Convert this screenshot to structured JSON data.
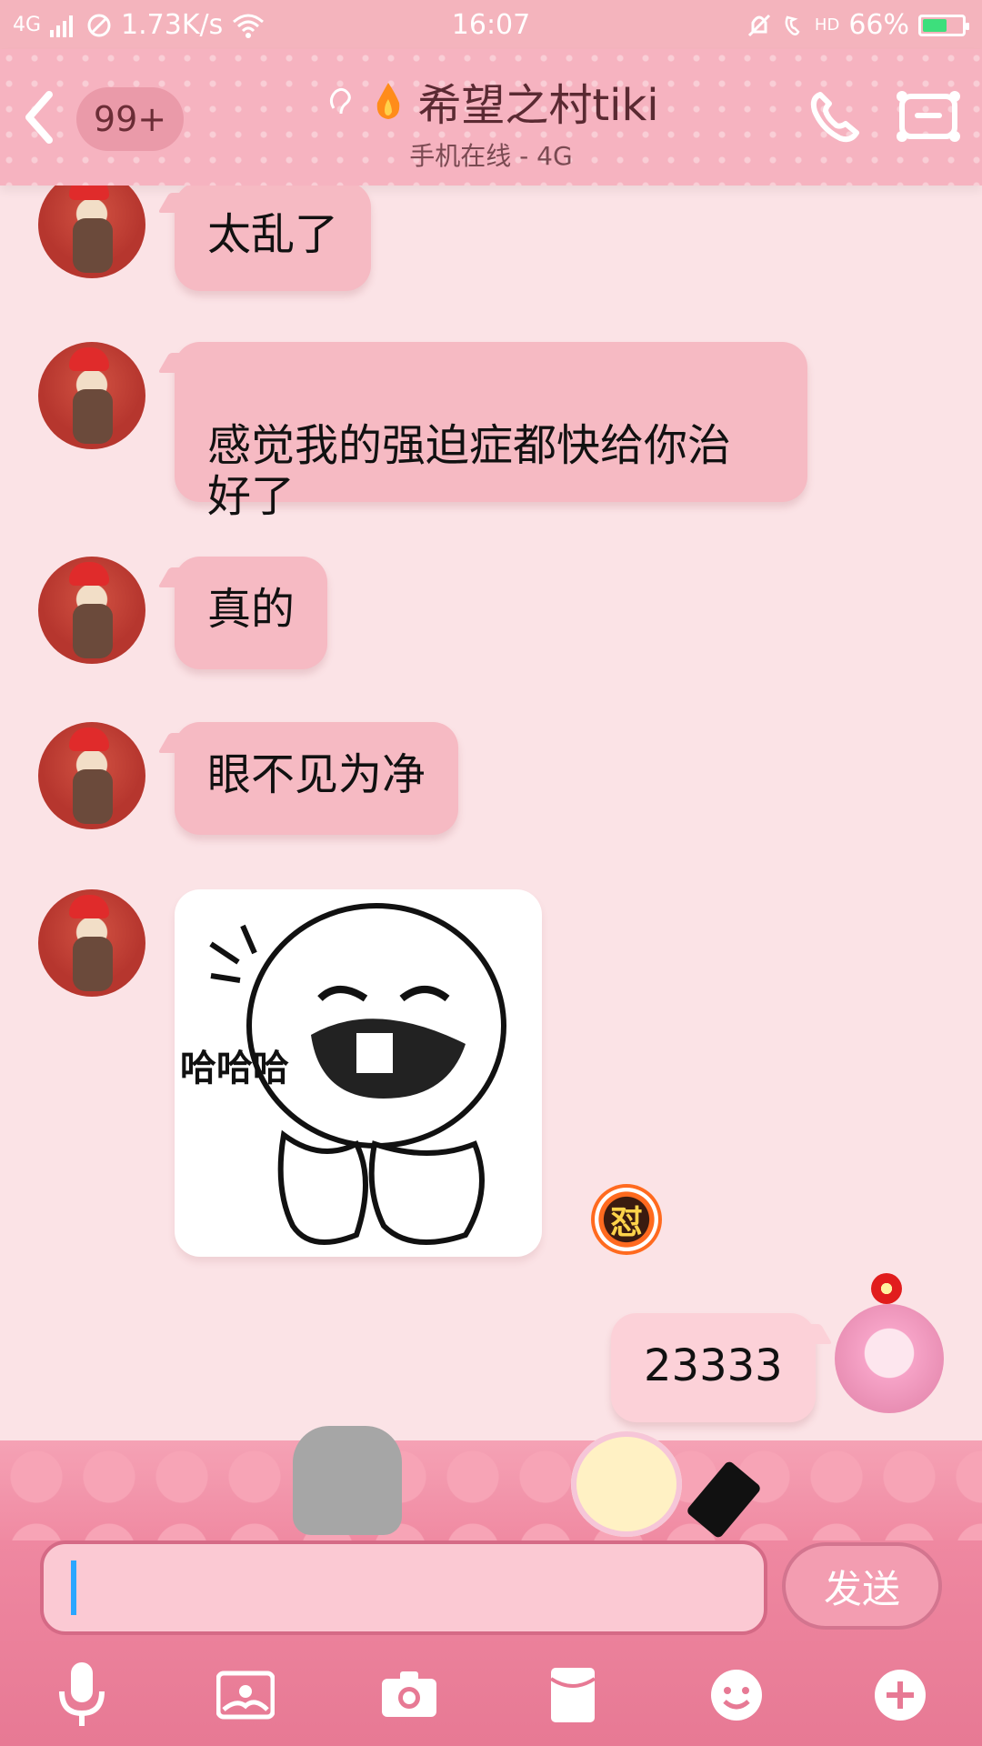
{
  "status_bar": {
    "network": "4G",
    "speed": "1.73K/s",
    "time": "16:07",
    "hd": "HD",
    "battery_percent": "66%",
    "battery_level": 0.66
  },
  "header": {
    "badge": "99+",
    "title": "希望之村tiki",
    "subtitle": "手机在线 - 4G"
  },
  "messages": [
    {
      "side": "left",
      "text": "太乱了"
    },
    {
      "side": "left",
      "text": "感觉我的强迫症都快给你治\n好了"
    },
    {
      "side": "left",
      "text": "真的"
    },
    {
      "side": "left",
      "text": "眼不见为净"
    },
    {
      "side": "left",
      "type": "sticker",
      "text": "哈哈哈"
    },
    {
      "side": "right",
      "text": "23333"
    }
  ],
  "reaction_badge": "怼",
  "input": {
    "placeholder": "",
    "value": ""
  },
  "send_label": "发送",
  "toolbar_icons": [
    "microphone-icon",
    "image-icon",
    "camera-icon",
    "red-packet-icon",
    "emoji-icon",
    "plus-icon"
  ],
  "colors": {
    "header_bg": "#f6b3c0",
    "bubble_left": "#f6bac3",
    "bubble_right": "#fcd1d8",
    "input_bar": "#e77994",
    "caret": "#2aa6ff"
  }
}
